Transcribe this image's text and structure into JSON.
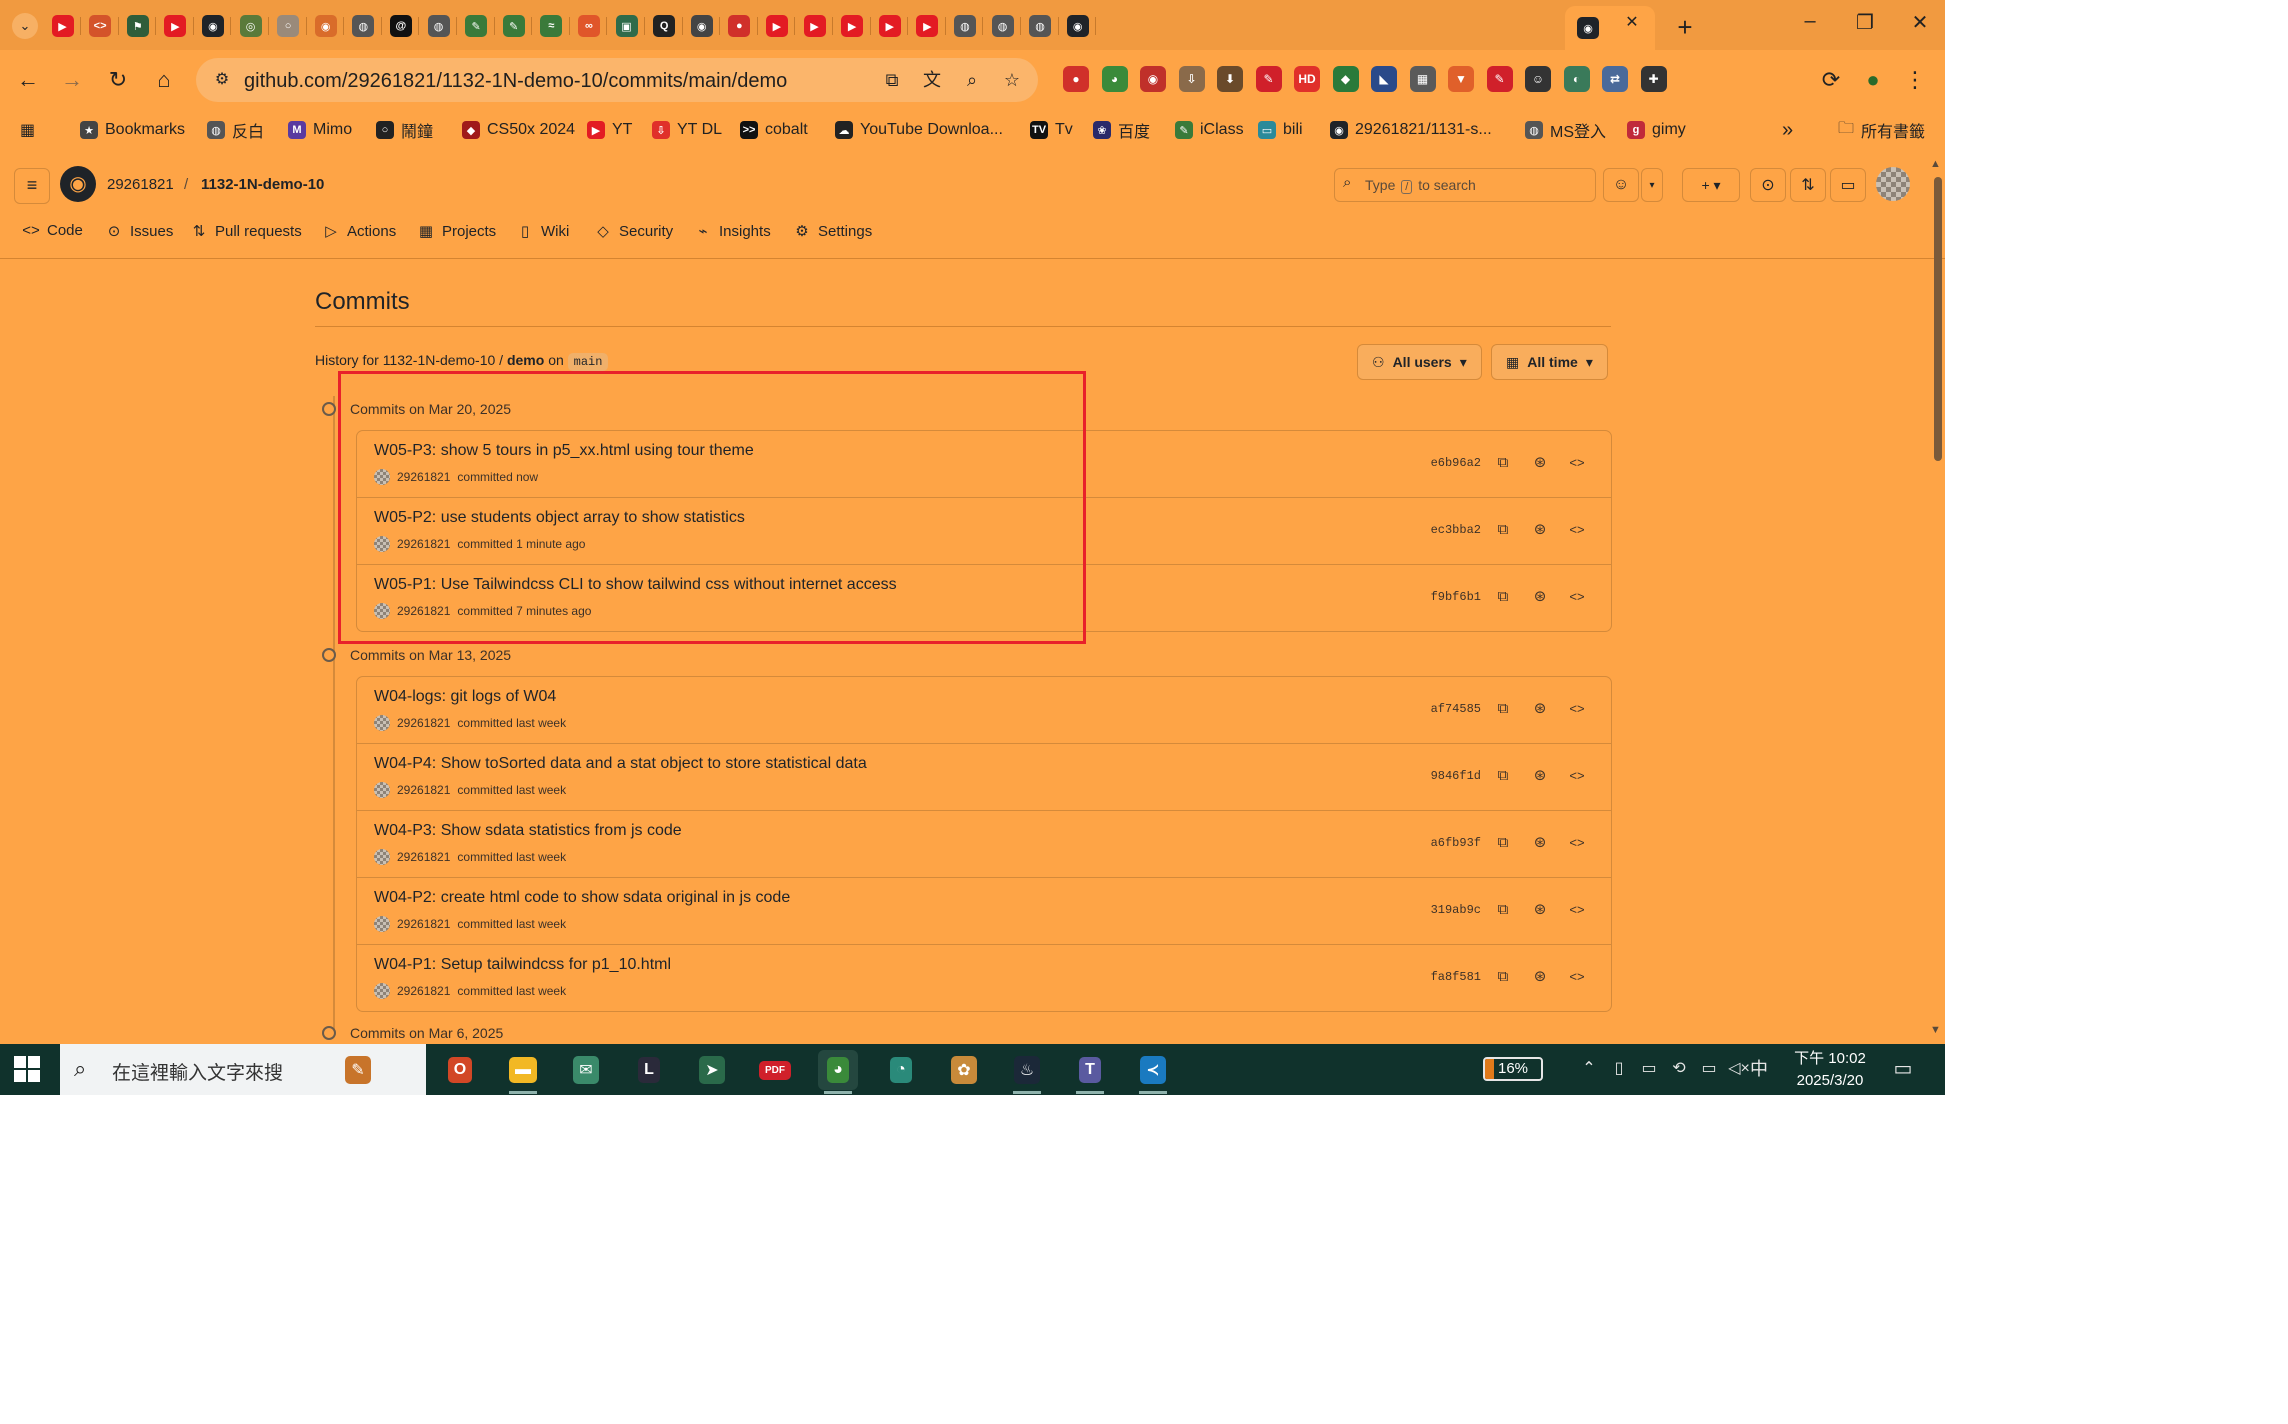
{
  "browser": {
    "tabs": [
      {
        "icon": "youtube-icon",
        "color": "#e31b23",
        "glyph": "▶"
      },
      {
        "icon": "code-icon",
        "color": "#d4532a",
        "glyph": "<>"
      },
      {
        "icon": "flag-icon",
        "color": "#2f5d3a",
        "glyph": "⚑"
      },
      {
        "icon": "youtube-icon",
        "color": "#e31b23",
        "glyph": "▶"
      },
      {
        "icon": "github-icon",
        "color": "#1f2328",
        "glyph": "◉"
      },
      {
        "icon": "chatgpt-icon",
        "color": "#5a7a3a",
        "glyph": "◎"
      },
      {
        "icon": "loading-icon",
        "color": "#9a8a7a",
        "glyph": "○"
      },
      {
        "icon": "app-icon",
        "color": "#d96c2a",
        "glyph": "◉"
      },
      {
        "icon": "globe-icon",
        "color": "#555555",
        "glyph": "◍"
      },
      {
        "icon": "threads-icon",
        "color": "#111111",
        "glyph": "@"
      },
      {
        "icon": "globe-icon",
        "color": "#555555",
        "glyph": "◍"
      },
      {
        "icon": "feather-icon",
        "color": "#3a7a3a",
        "glyph": "✎"
      },
      {
        "icon": "feather-icon",
        "color": "#3a7a3a",
        "glyph": "✎"
      },
      {
        "icon": "wave-icon",
        "color": "#3a7a3a",
        "glyph": "≈"
      },
      {
        "icon": "link-icon",
        "color": "#e0562a",
        "glyph": "∞"
      },
      {
        "icon": "image-icon",
        "color": "#2f6b4a",
        "glyph": "▣"
      },
      {
        "icon": "quiz-icon",
        "color": "#222222",
        "glyph": "Q"
      },
      {
        "icon": "github-icon",
        "color": "#444444",
        "glyph": "◉"
      },
      {
        "icon": "record-icon",
        "color": "#d0302a",
        "glyph": "●"
      },
      {
        "icon": "youtube-icon",
        "color": "#e31b23",
        "glyph": "▶"
      },
      {
        "icon": "youtube-icon",
        "color": "#e31b23",
        "glyph": "▶"
      },
      {
        "icon": "youtube-icon",
        "color": "#e31b23",
        "glyph": "▶"
      },
      {
        "icon": "youtube-icon",
        "color": "#e31b23",
        "glyph": "▶"
      },
      {
        "icon": "youtube-icon",
        "color": "#e31b23",
        "glyph": "▶"
      },
      {
        "icon": "globe-icon",
        "color": "#555555",
        "glyph": "◍"
      },
      {
        "icon": "globe-icon",
        "color": "#555555",
        "glyph": "◍"
      },
      {
        "icon": "globe-icon",
        "color": "#555555",
        "glyph": "◍"
      },
      {
        "icon": "github-icon",
        "color": "#1f2328",
        "glyph": "◉"
      },
      {
        "icon": "github-icon",
        "color": "#1f2328",
        "glyph": "◉",
        "active": true
      }
    ],
    "active_tab_close": "✕",
    "new_tab": "+",
    "window_controls": {
      "minimize": "–",
      "maximize": "❐",
      "close": "✕"
    }
  },
  "toolbar": {
    "back": "←",
    "forward": "→",
    "reload": "↻",
    "home": "⌂",
    "tune": "⚙",
    "url": "github.com/29261821/1132-1N-demo-10/commits/main/demo",
    "omni_icons": [
      "cast-icon",
      "translate-icon",
      "zoom-icon",
      "star-icon"
    ],
    "omni_glyphs": [
      "⧉",
      "文",
      "⌕",
      "☆"
    ],
    "extensions": [
      {
        "icon": "record-extension-icon",
        "color": "#d0302a",
        "glyph": "●"
      },
      {
        "icon": "chrome-extension-icon",
        "color": "#3a8a3a",
        "glyph": "◕"
      },
      {
        "icon": "eye-extension-icon",
        "color": "#c0302a",
        "glyph": "◉"
      },
      {
        "icon": "download-extension-icon",
        "color": "#8a6a4a",
        "glyph": "⇩"
      },
      {
        "icon": "download-extension-icon",
        "color": "#6a4a2a",
        "glyph": "⬇"
      },
      {
        "icon": "pen-extension-icon",
        "color": "#d0202a",
        "glyph": "✎"
      },
      {
        "icon": "hd-extension-icon",
        "color": "#e0302a",
        "glyph": "HD"
      },
      {
        "icon": "shield-extension-icon",
        "color": "#2a7a3a",
        "glyph": "◆"
      },
      {
        "icon": "tag-extension-icon",
        "color": "#2a4a8a",
        "glyph": "◣"
      },
      {
        "icon": "grid-extension-icon",
        "color": "#5a5a5a",
        "glyph": "▦"
      },
      {
        "icon": "brave-extension-icon",
        "color": "#e0602a",
        "glyph": "▼"
      },
      {
        "icon": "edit-extension-icon",
        "color": "#d0202a",
        "glyph": "✎"
      },
      {
        "icon": "face-extension-icon",
        "color": "#333333",
        "glyph": "☺"
      },
      {
        "icon": "swirl-extension-icon",
        "color": "#3a7a5a",
        "glyph": "◐"
      },
      {
        "icon": "translate-extension-icon",
        "color": "#4a6a9a",
        "glyph": "⇄"
      },
      {
        "icon": "puzzle-extension-icon",
        "color": "#333333",
        "glyph": "✚"
      }
    ],
    "profile_icons": [
      "sync-icon",
      "profile-avatar-icon",
      "menu-dots-icon"
    ],
    "profile_glyphs": [
      "⟳",
      "●",
      "⋮"
    ]
  },
  "bookmarks": {
    "apps_glyph": "▦",
    "items": [
      {
        "label": "Bookmarks",
        "icon": "star-icon",
        "color": "#444444",
        "glyph": "★"
      },
      {
        "label": "反白",
        "icon": "globe-icon",
        "color": "#555555",
        "glyph": "◍"
      },
      {
        "label": "Mimo",
        "icon": "mimo-icon",
        "color": "#5a3aa0",
        "glyph": "M"
      },
      {
        "label": "鬧鐘",
        "icon": "clock-icon",
        "color": "#222222",
        "glyph": "○"
      },
      {
        "label": "CS50x 2024",
        "icon": "shield-icon",
        "color": "#a01a1a",
        "glyph": "◆"
      },
      {
        "label": "YT",
        "icon": "youtube-icon",
        "color": "#e31b23",
        "glyph": "▶"
      },
      {
        "label": "YT DL",
        "icon": "download-icon",
        "color": "#e0302a",
        "glyph": "⇩"
      },
      {
        "label": "cobalt",
        "icon": "terminal-icon",
        "color": "#111111",
        "glyph": ">>"
      },
      {
        "label": "YouTube Downloa...",
        "icon": "cloud-icon",
        "color": "#222222",
        "glyph": "☁"
      },
      {
        "label": "Tv",
        "icon": "tv-icon",
        "color": "#111111",
        "glyph": "TV"
      },
      {
        "label": "百度",
        "icon": "paw-icon",
        "color": "#2a2a6a",
        "glyph": "❀"
      },
      {
        "label": "iClass",
        "icon": "feather-icon",
        "color": "#3a7a3a",
        "glyph": "✎"
      },
      {
        "label": "bili",
        "icon": "bilibili-icon",
        "color": "#2a8a9a",
        "glyph": "▭"
      },
      {
        "label": "29261821/1131-s...",
        "icon": "github-icon",
        "color": "#1f2328",
        "glyph": "◉"
      },
      {
        "label": "MS登入",
        "icon": "globe-icon",
        "color": "#555555",
        "glyph": "◍"
      },
      {
        "label": "gimy",
        "icon": "gimy-icon",
        "color": "#c02a3a",
        "glyph": "g"
      }
    ],
    "more": "»",
    "all_bookmarks": "所有書籤"
  },
  "github": {
    "owner": "29261821",
    "separator": "/",
    "repo": "1132-1N-demo-10",
    "search_prefix": "Type",
    "search_key": "/",
    "search_suffix": "to search",
    "nav": [
      {
        "label": "Code",
        "icon": "code-icon",
        "glyph": "<>"
      },
      {
        "label": "Issues",
        "icon": "issue-icon",
        "glyph": "⊙"
      },
      {
        "label": "Pull requests",
        "icon": "pull-request-icon",
        "glyph": "⇅"
      },
      {
        "label": "Actions",
        "icon": "play-icon",
        "glyph": "▷"
      },
      {
        "label": "Projects",
        "icon": "table-icon",
        "glyph": "▦"
      },
      {
        "label": "Wiki",
        "icon": "book-icon",
        "glyph": "▯"
      },
      {
        "label": "Security",
        "icon": "shield-icon",
        "glyph": "◇"
      },
      {
        "label": "Insights",
        "icon": "graph-icon",
        "glyph": "⌁"
      },
      {
        "label": "Settings",
        "icon": "gear-icon",
        "glyph": "⚙"
      }
    ],
    "page_title": "Commits",
    "history_prefix": "History for",
    "history_repo": "1132-1N-demo-10",
    "history_sep": "/",
    "history_path": "demo",
    "history_on": "on",
    "history_branch": "main",
    "filters": {
      "users": "All users",
      "time": "All time"
    },
    "groups": [
      {
        "header": "Commits on Mar 20, 2025",
        "commits": [
          {
            "message": "W05-P3: show 5 tours in p5_xx.html using tour theme",
            "author": "29261821",
            "meta": "committed now",
            "sha": "e6b96a2"
          },
          {
            "message": "W05-P2: use students object array to show statistics",
            "author": "29261821",
            "meta": "committed 1 minute ago",
            "sha": "ec3bba2"
          },
          {
            "message": "W05-P1: Use Tailwindcss CLI to show tailwind css without internet access",
            "author": "29261821",
            "meta": "committed 7 minutes ago",
            "sha": "f9bf6b1"
          }
        ]
      },
      {
        "header": "Commits on Mar 13, 2025",
        "commits": [
          {
            "message": "W04-logs: git logs of W04",
            "author": "29261821",
            "meta": "committed last week",
            "sha": "af74585"
          },
          {
            "message": "W04-P4: Show toSorted data and a stat object to store statistical data",
            "author": "29261821",
            "meta": "committed last week",
            "sha": "9846f1d"
          },
          {
            "message": "W04-P3: Show sdata statistics from js code",
            "author": "29261821",
            "meta": "committed last week",
            "sha": "a6fb93f"
          },
          {
            "message": "W04-P2: create html code to show sdata original in js code",
            "author": "29261821",
            "meta": "committed last week",
            "sha": "319ab9c"
          },
          {
            "message": "W04-P1: Setup tailwindcss for p1_10.html",
            "author": "29261821",
            "meta": "committed last week",
            "sha": "fa8f581"
          }
        ]
      },
      {
        "header": "Commits on Mar 6, 2025",
        "commits": []
      }
    ]
  },
  "taskbar": {
    "search_placeholder": "在這裡輸入文字來搜",
    "apps": [
      {
        "icon": "widget-icon",
        "color": "#c8742a",
        "glyph": "✎"
      },
      {
        "icon": "office-icon",
        "color": "#d24726",
        "glyph": "O"
      },
      {
        "icon": "file-explorer-icon",
        "color": "#f2b824",
        "glyph": "▬",
        "running": true
      },
      {
        "icon": "mail-icon",
        "color": "#3a8a6a",
        "glyph": "✉"
      },
      {
        "icon": "launcher-icon",
        "color": "#2a2a3a",
        "glyph": "L"
      },
      {
        "icon": "vpn-icon",
        "color": "#2a6a4a",
        "glyph": "➤"
      },
      {
        "icon": "pdf-icon",
        "color": "#d0202a",
        "glyph": "PDF"
      },
      {
        "icon": "chrome-icon",
        "color": "#3a8a3a",
        "glyph": "◕",
        "running": true,
        "active": true
      },
      {
        "icon": "edge-icon",
        "color": "#2a8a7a",
        "glyph": "◔"
      },
      {
        "icon": "paint-icon",
        "color": "#c88a3a",
        "glyph": "✿"
      },
      {
        "icon": "steam-icon",
        "color": "#1b2838",
        "glyph": "♨",
        "running": true
      },
      {
        "icon": "teams-icon",
        "color": "#5a5aa0",
        "glyph": "T",
        "running": true
      },
      {
        "icon": "vscode-icon",
        "color": "#1a7ac0",
        "glyph": "≺",
        "running": true
      }
    ],
    "battery_pct": "16%",
    "battery_level": 0.16,
    "tray_glyphs": [
      "⌃",
      "▯",
      "▭",
      "⟲",
      "▭",
      "◁×",
      "中"
    ],
    "tray_icons": [
      "show-hidden-icons-icon",
      "device-icon",
      "battery-tray-icon",
      "sync-icon",
      "network-icon",
      "volume-muted-icon",
      "input-method-icon"
    ],
    "clock_time": "下午 10:02",
    "clock_date": "2025/3/20",
    "notification_glyph": "▭"
  }
}
